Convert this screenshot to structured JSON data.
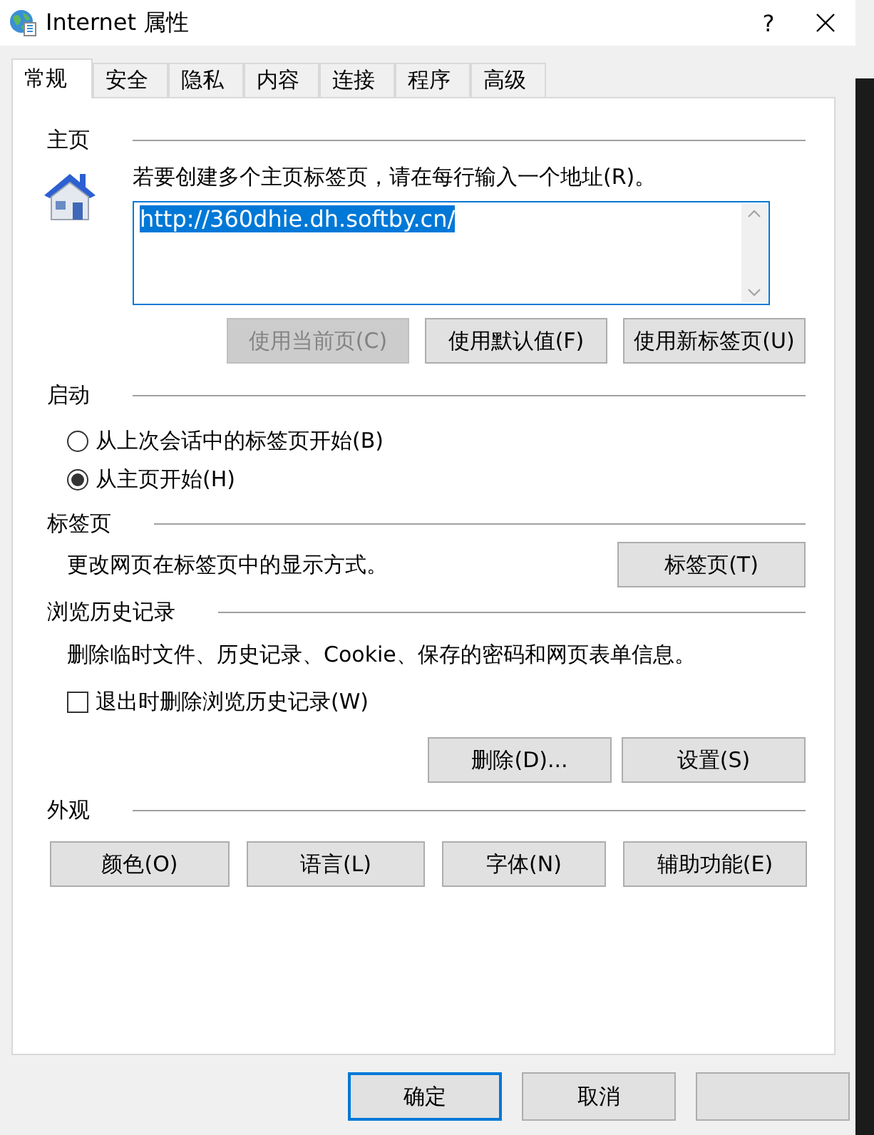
{
  "window": {
    "title": "Internet 属性",
    "help": "?"
  },
  "tabs": [
    {
      "label": "常规",
      "selected": true
    },
    {
      "label": "安全",
      "selected": false
    },
    {
      "label": "隐私",
      "selected": false
    },
    {
      "label": "内容",
      "selected": false
    },
    {
      "label": "连接",
      "selected": false
    },
    {
      "label": "程序",
      "selected": false
    },
    {
      "label": "高级",
      "selected": false
    }
  ],
  "homepage": {
    "heading": "主页",
    "instruction": "若要创建多个主页标签页，请在每行输入一个地址(R)。",
    "value": "http://360dhie.dh.softby.cn/",
    "value_selected": true,
    "buttons": [
      {
        "label": "使用当前页(C)",
        "disabled": true
      },
      {
        "label": "使用默认值(F)",
        "disabled": false
      },
      {
        "label": "使用新标签页(U)",
        "disabled": false
      }
    ]
  },
  "startup": {
    "heading": "启动",
    "options": [
      {
        "label": "从上次会话中的标签页开始(B)",
        "selected": false
      },
      {
        "label": "从主页开始(H)",
        "selected": true
      }
    ]
  },
  "tabs_section": {
    "heading": "标签页",
    "description": "更改网页在标签页中的显示方式。",
    "button": "标签页(T)"
  },
  "history": {
    "heading": "浏览历史记录",
    "description": "删除临时文件、历史记录、Cookie、保存的密码和网页表单信息。",
    "checkbox": {
      "label": "退出时删除浏览历史记录(W)",
      "checked": false
    },
    "buttons": [
      "删除(D)...",
      "设置(S)"
    ]
  },
  "appearance": {
    "heading": "外观",
    "buttons": [
      "颜色(O)",
      "语言(L)",
      "字体(N)",
      "辅助功能(E)"
    ]
  },
  "footer_buttons": [
    {
      "label": "确定",
      "default": true
    },
    {
      "label": "取消",
      "default": false
    },
    {
      "default": false
    }
  ]
}
